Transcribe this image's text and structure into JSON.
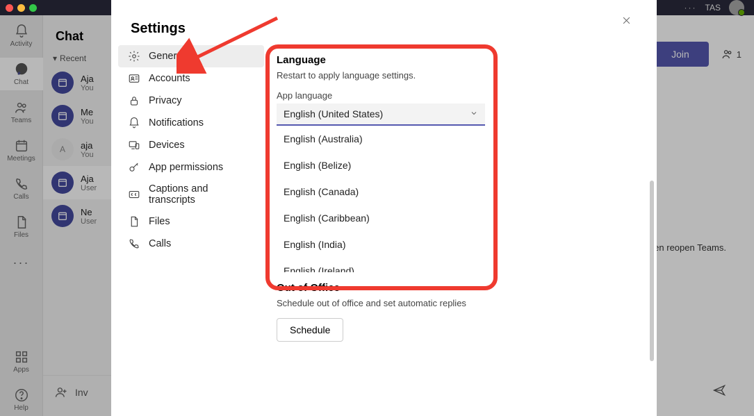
{
  "topbar": {
    "dots": "···",
    "user_tag": "TAS"
  },
  "rail": {
    "activity": "Activity",
    "chat": "Chat",
    "teams": "Teams",
    "meetings": "Meetings",
    "calls": "Calls",
    "files": "Files",
    "apps": "Apps",
    "help": "Help",
    "more": "···"
  },
  "chat_panel": {
    "title": "Chat",
    "recent": "Recent",
    "rows": [
      {
        "name": "Aja",
        "sub": "You"
      },
      {
        "name": "Me",
        "sub": "You"
      },
      {
        "name": "aja",
        "sub": "You",
        "initials": "A"
      },
      {
        "name": "Aja",
        "sub": "User"
      },
      {
        "name": "Ne",
        "sub": "User"
      }
    ],
    "invite": "Inv"
  },
  "main": {
    "join": "Join",
    "people_count": "1",
    "hint_line1": "select Quit. Then reopen Teams.",
    "hint_line2": ")"
  },
  "settings": {
    "title": "Settings",
    "nav": {
      "general": "General",
      "accounts": "Accounts",
      "privacy": "Privacy",
      "notifications": "Notifications",
      "devices": "Devices",
      "app_permissions": "App permissions",
      "captions": "Captions and transcripts",
      "files": "Files",
      "calls": "Calls"
    },
    "language": {
      "title": "Language",
      "subtitle": "Restart to apply language settings.",
      "field_label": "App language",
      "selected": "English (United States)",
      "options": [
        "English (Australia)",
        "English (Belize)",
        "English (Canada)",
        "English (Caribbean)",
        "English (India)",
        "English (Ireland)"
      ]
    },
    "ooo": {
      "title": "Out of Office",
      "subtitle": "Schedule out of office and set automatic replies",
      "button": "Schedule"
    }
  }
}
